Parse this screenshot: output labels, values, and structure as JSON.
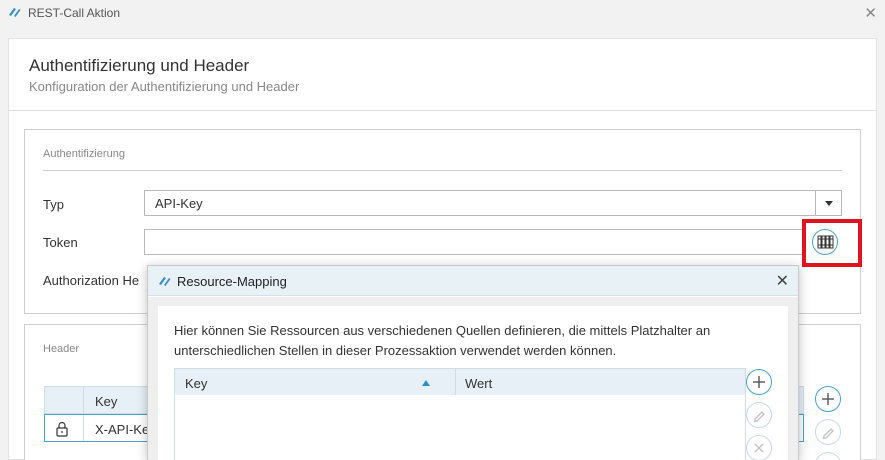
{
  "window": {
    "title": "REST-Call Aktion",
    "close_icon": "close-icon"
  },
  "page": {
    "title": "Authentifizierung und Header",
    "subtitle": "Konfiguration der Authentifizierung und Header"
  },
  "auth": {
    "group_title": "Authentifizierung",
    "type_label": "Typ",
    "type_value": "API-Key",
    "token_label": "Token",
    "token_value": "",
    "authorization_label": "Authorization He"
  },
  "header": {
    "group_title": "Header",
    "columns": [
      "",
      "Key"
    ],
    "rows": [
      {
        "locked": true,
        "key": "X-API-Key"
      }
    ]
  },
  "dialog": {
    "title": "Resource-Mapping",
    "description": "Hier können Sie Ressourcen aus verschiedenen Quellen definieren, die mittels Platzhalter an unterschiedlichen Stellen in dieser Prozessaktion verwendet werden können.",
    "columns": {
      "key": "Key",
      "value": "Wert"
    },
    "sort": "ascending"
  },
  "colors": {
    "accent": "#4ba3c7",
    "highlight": "#e0141e",
    "table_header": "#e6f0f6"
  }
}
